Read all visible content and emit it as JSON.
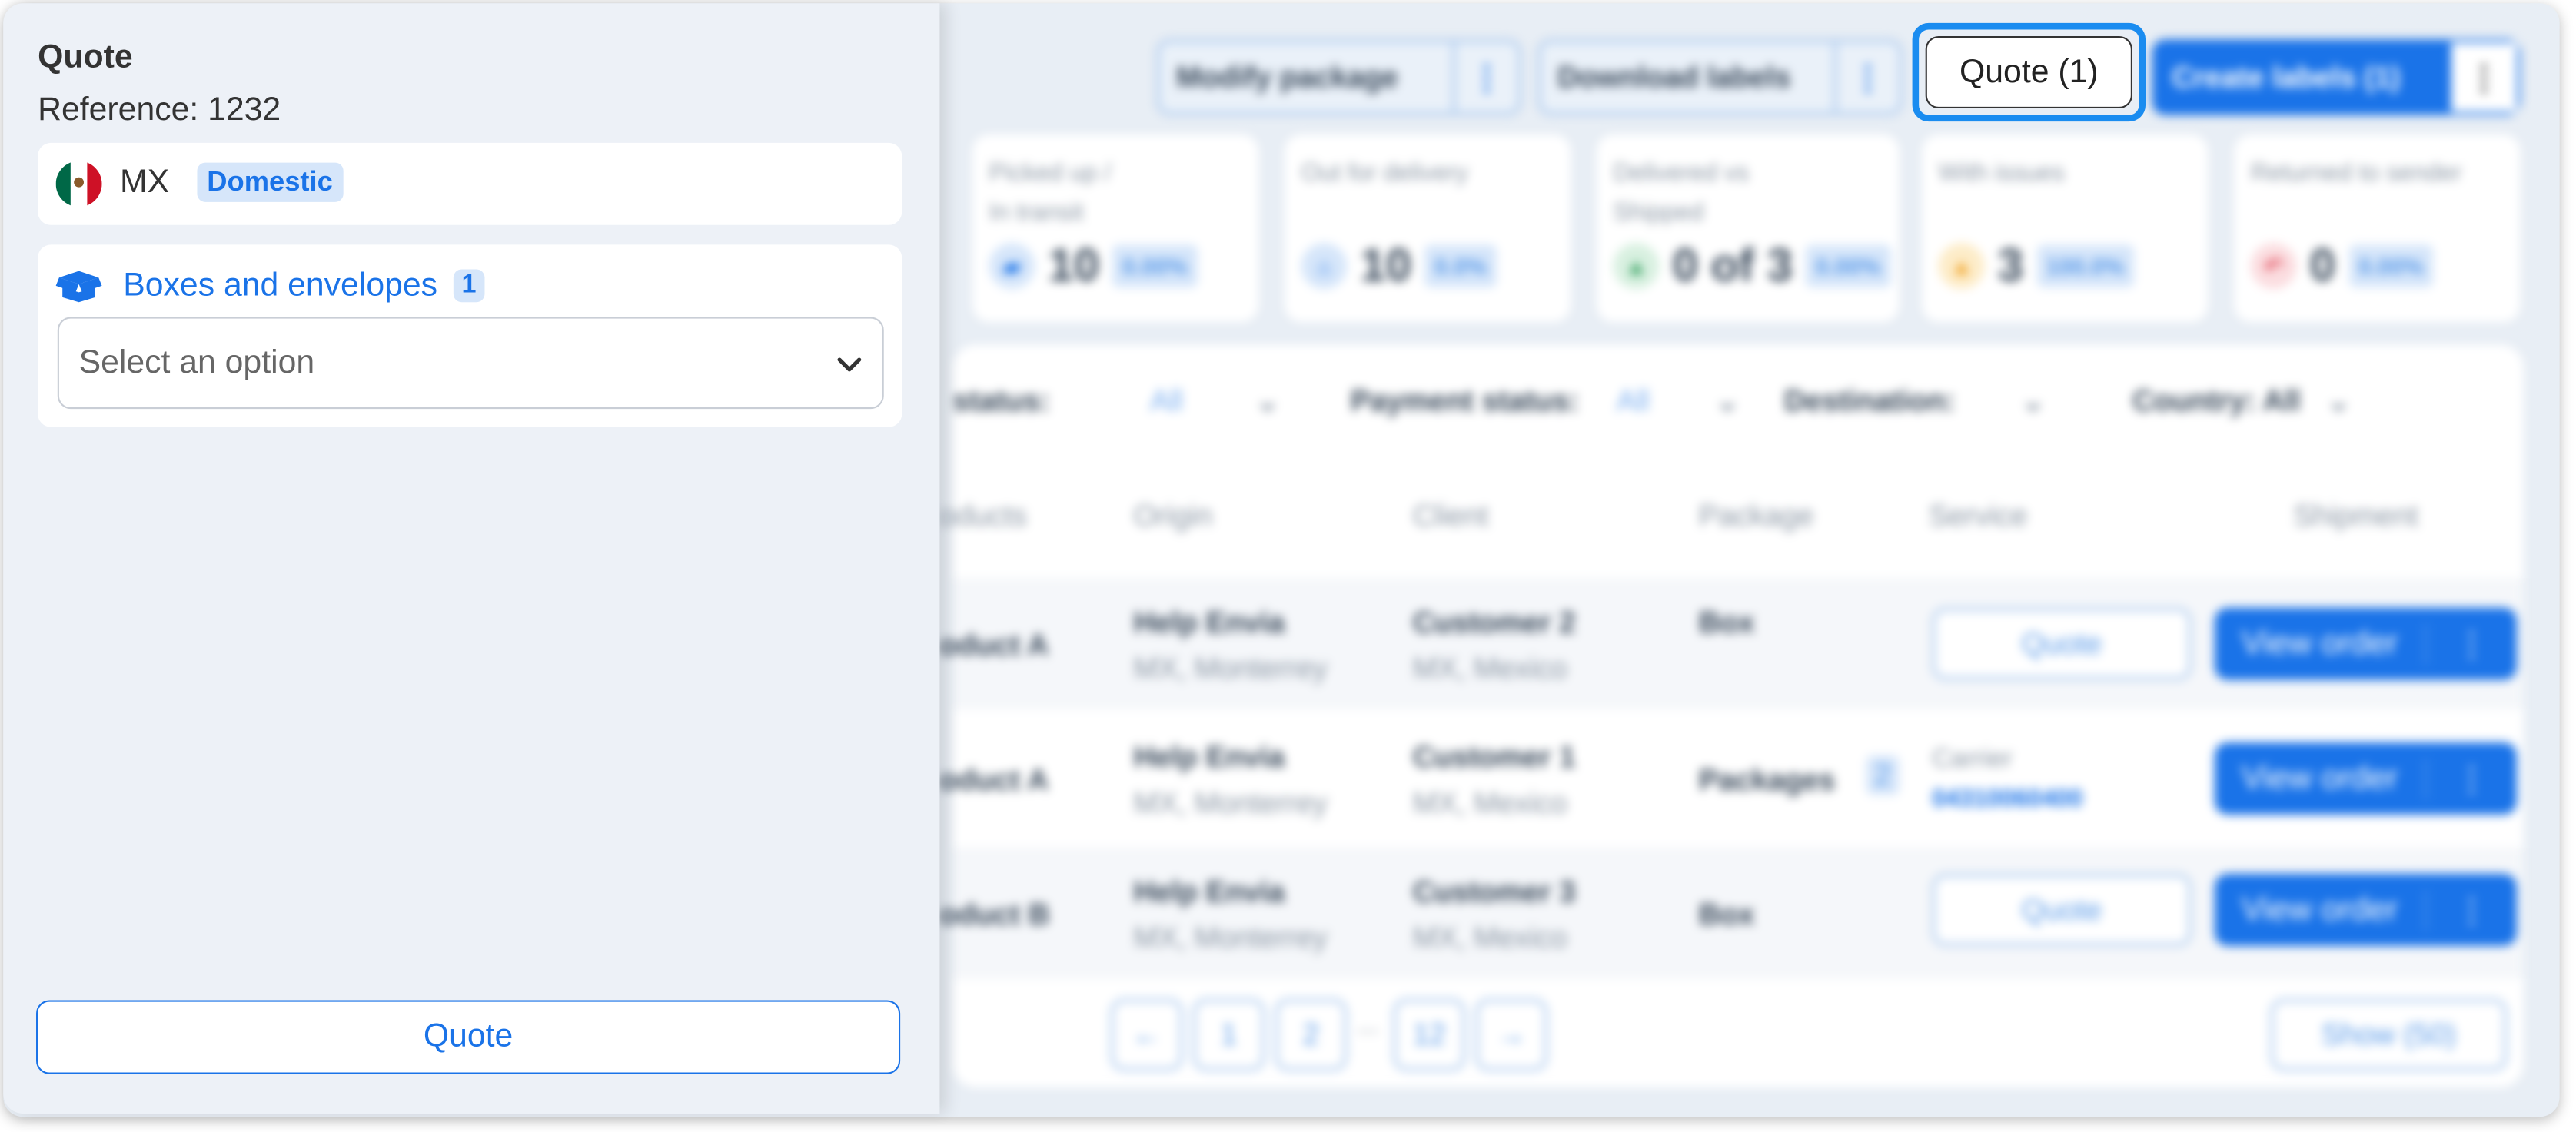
{
  "toolbar": {
    "modify_label": "Modify package",
    "download_label": "Download labels",
    "quote_label": "Quote (1)",
    "create_label": "Create labels (1)"
  },
  "stats": [
    {
      "title_l1": "Picked up /",
      "title_l2": "In transit",
      "value": "10",
      "pct": "0.00%"
    },
    {
      "title_l1": "Out for delivery",
      "title_l2": "",
      "value": "10",
      "pct": "0.0%"
    },
    {
      "title_l1": "Delivered vs",
      "title_l2": "Shipped",
      "value": "0 of 3",
      "pct": "0.00%"
    },
    {
      "title_l1": "With issues",
      "title_l2": "",
      "value": "3",
      "pct": "100.0%"
    },
    {
      "title_l1": "Returned to sender",
      "title_l2": "",
      "value": "0",
      "pct": "0.00%"
    }
  ],
  "filters": {
    "status_label": "status:",
    "status_value": "All",
    "payment_label": "Payment status:",
    "payment_value": "All",
    "destination_label": "Destination:",
    "country_label": "Country: All"
  },
  "table": {
    "headers": [
      "oducts",
      "Origin",
      "Client",
      "Package",
      "Service",
      "Shipment"
    ],
    "rows": [
      {
        "product": "oduct A",
        "origin_name": "Help Envia",
        "origin_loc": "MX, Monterrey",
        "client_name": "Customer 2",
        "client_loc": "MX, Mexico",
        "package": "Box",
        "service": "Quote",
        "action": "View order"
      },
      {
        "product": "oduct A",
        "origin_name": "Help Envia",
        "origin_loc": "MX, Monterrey",
        "client_name": "Customer 1",
        "client_loc": "MX, Mexico",
        "package": "Packages",
        "package_count": "2",
        "carrier": "Carrier",
        "tracking": "04310060400",
        "action": "View order"
      },
      {
        "product": "oduct B",
        "origin_name": "Help Envia",
        "origin_loc": "MX, Monterrey",
        "client_name": "Customer 3",
        "client_loc": "MX, Mexico",
        "package": "Box",
        "service": "Quote",
        "action": "View order"
      }
    ]
  },
  "pagination": {
    "prev": "←",
    "p1": "1",
    "p2": "2",
    "ellipsis": "...",
    "last": "12",
    "next": "→",
    "show": "Show (50)"
  },
  "side": {
    "title": "Quote",
    "reference": "Reference: 1232",
    "country": "MX",
    "scope_badge": "Domestic",
    "boxes_label": "Boxes and envelopes",
    "boxes_count": "1",
    "select_placeholder": "Select an option",
    "quote_button": "Quote"
  },
  "colors": {
    "accent": "#1a73e8",
    "panel_bg": "#edf1f7",
    "badge_bg": "#d6e6fa"
  }
}
